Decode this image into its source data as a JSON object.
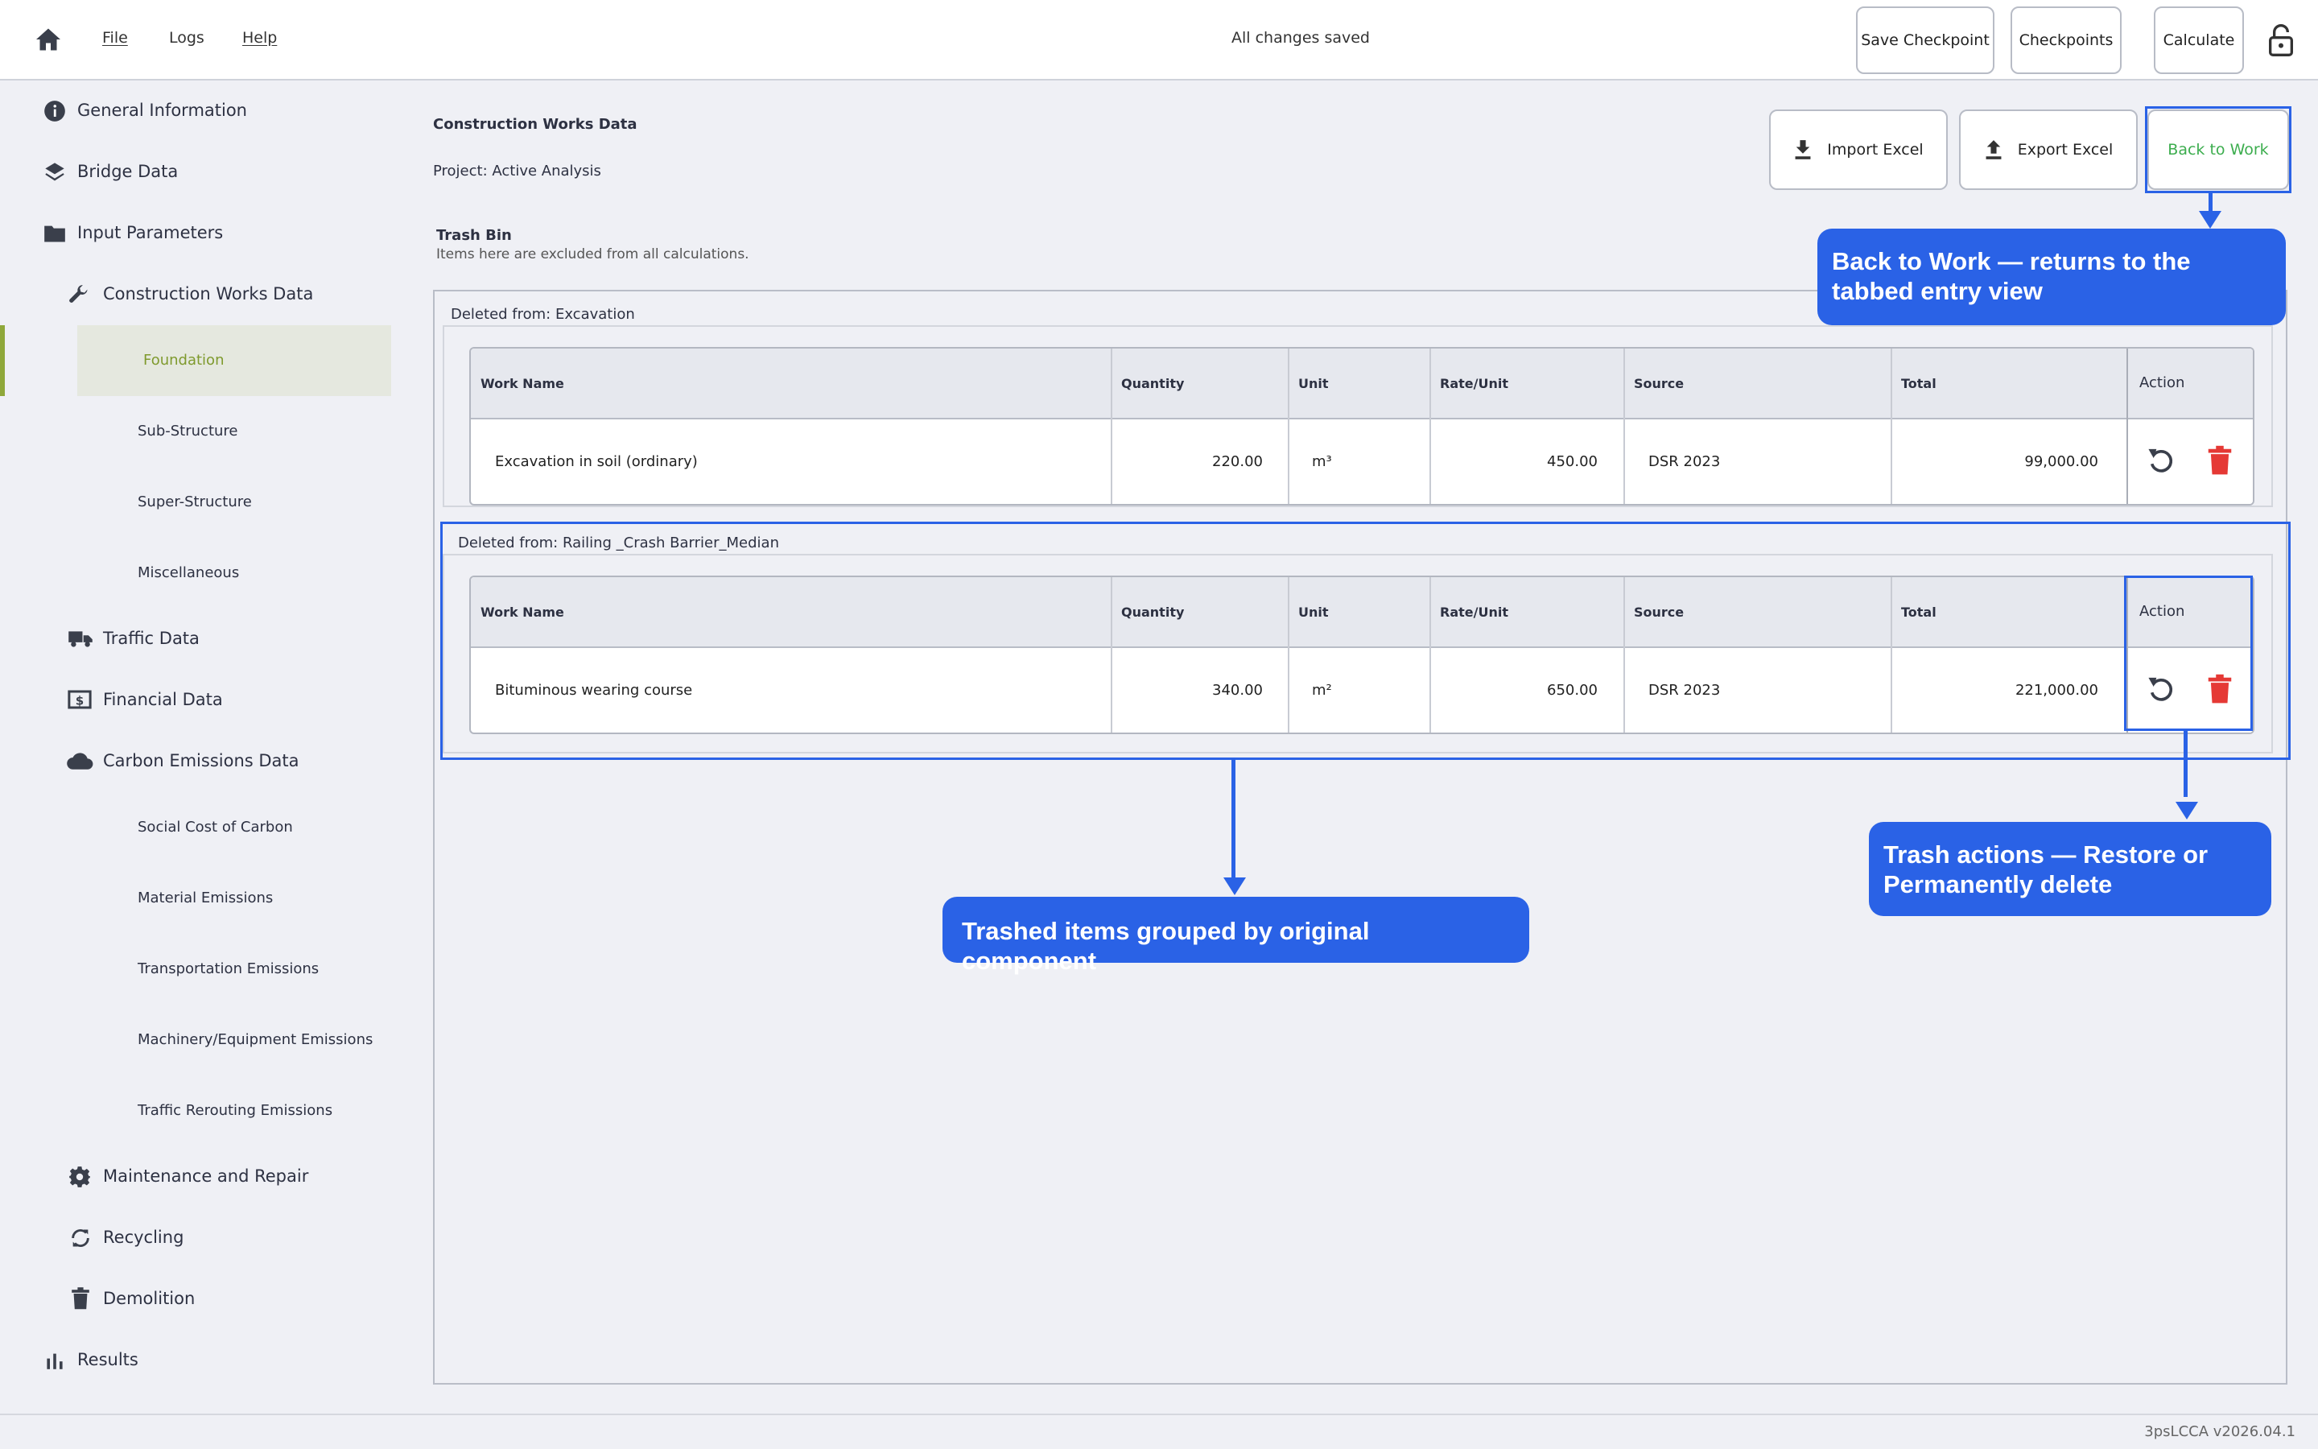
{
  "menu": {
    "file": "File",
    "logs": "Logs",
    "help": "Help"
  },
  "status": "All changes saved",
  "top_buttons": {
    "save_checkpoint": "Save Checkpoint",
    "checkpoints": "Checkpoints",
    "calculate": "Calculate"
  },
  "sidebar": {
    "general": "General Information",
    "bridge": "Bridge Data",
    "input": "Input Parameters",
    "construction": "Construction Works Data",
    "construction_items": [
      "Foundation",
      "Sub-Structure",
      "Super-Structure",
      "Miscellaneous"
    ],
    "traffic": "Traffic Data",
    "financial": "Financial Data",
    "carbon": "Carbon Emissions Data",
    "carbon_items": [
      "Social Cost of Carbon",
      "Material Emissions",
      "Transportation Emissions",
      "Machinery/Equipment Emissions",
      "Traffic Rerouting Emissions"
    ],
    "maintenance": "Maintenance and Repair",
    "recycling": "Recycling",
    "demolition": "Demolition",
    "results": "Results"
  },
  "main": {
    "title": "Construction Works Data",
    "project": "Project: Active Analysis",
    "import": "Import Excel",
    "export": "Export Excel",
    "back": "Back to Work",
    "trash_title": "Trash Bin",
    "trash_note": "Items here are excluded from all calculations."
  },
  "columns": [
    "Work Name",
    "Quantity",
    "Unit",
    "Rate/Unit",
    "Source",
    "Total",
    "Action"
  ],
  "groups": [
    {
      "title": "Deleted from: Excavation",
      "row": {
        "name": "Excavation in soil (ordinary)",
        "qty": "220.00",
        "unit": "m³",
        "rate": "450.00",
        "source": "DSR 2023",
        "total": "99,000.00"
      }
    },
    {
      "title": "Deleted from: Railing _Crash Barrier_Median",
      "row": {
        "name": "Bituminous wearing course",
        "qty": "340.00",
        "unit": "m²",
        "rate": "650.00",
        "source": "DSR 2023",
        "total": "221,000.00"
      }
    }
  ],
  "annotations": {
    "back": "Back to Work — returns to the tabbed entry view",
    "grouped": "Trashed items grouped by original component",
    "actions": "Trash actions — Restore or Permanently delete"
  },
  "version": "3psLCCA v2026.04.1",
  "colors": {
    "accent_green": "#8fa83a",
    "back_text": "#3cad4e",
    "callout": "#2a62e6",
    "delete": "#e53935"
  }
}
